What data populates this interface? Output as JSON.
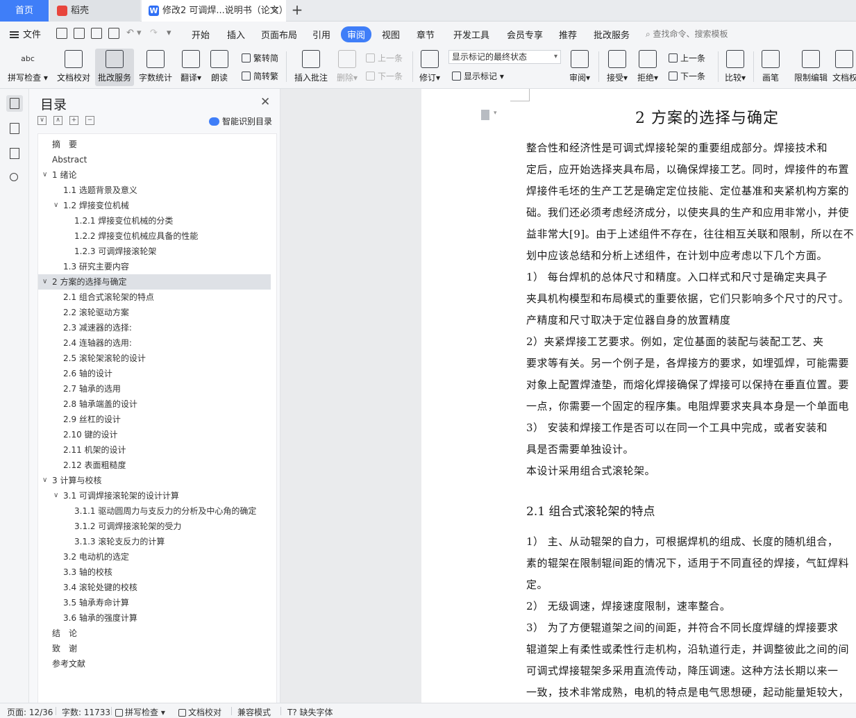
{
  "tabs": {
    "home": "首页",
    "tab1": "稻壳",
    "tab2": "修改2 可调焊...说明书（论文）"
  },
  "menu": {
    "file": "文件",
    "items": [
      "开始",
      "插入",
      "页面布局",
      "引用",
      "审阅",
      "视图",
      "章节",
      "开发工具",
      "会员专享",
      "推荐",
      "批改服务"
    ],
    "active": "审阅",
    "search": "查找命令、搜索模板"
  },
  "ribbon": {
    "spellcheck": "拼写检查",
    "doc_proof": "文档校对",
    "review_service": "批改服务",
    "word_count": "字数统计",
    "translate": "翻译",
    "read_aloud": "朗读",
    "to_simplified": "繁转简",
    "to_traditional": "简转繁",
    "insert_comment": "插入批注",
    "delete": "删除",
    "prev_comment": "上一条",
    "next_comment": "下一条",
    "revise": "修订",
    "markup_mode": "显示标记的最终状态",
    "show_markup": "显示标记",
    "review_pane": "审阅",
    "accept": "接受",
    "reject": "拒绝",
    "prev_change": "上一条",
    "next_change": "下一条",
    "compare": "比较",
    "pen": "画笔",
    "restrict_edit": "限制编辑",
    "doc_permission": "文档权"
  },
  "toc": {
    "title": "目录",
    "smart": "智能识别目录",
    "items": [
      {
        "label": "摘　要",
        "level": 1,
        "arrow": ""
      },
      {
        "label": "Abstract",
        "level": 1,
        "arrow": ""
      },
      {
        "label": "1  绪论",
        "level": 1,
        "arrow": "∨"
      },
      {
        "label": "1.1 选题背景及意义",
        "level": 2,
        "arrow": ""
      },
      {
        "label": "1.2 焊接变位机械",
        "level": 2,
        "arrow": "∨"
      },
      {
        "label": "1.2.1 焊接变位机械的分类",
        "level": 3,
        "arrow": ""
      },
      {
        "label": "1.2.2 焊接变位机械应具备的性能",
        "level": 3,
        "arrow": ""
      },
      {
        "label": "1.2.3 可调焊接滚轮架",
        "level": 3,
        "arrow": ""
      },
      {
        "label": "1.3  研究主要内容",
        "level": 2,
        "arrow": ""
      },
      {
        "label": "2  方案的选择与确定",
        "level": 1,
        "arrow": "∨"
      },
      {
        "label": "2.1 组合式滚轮架的特点",
        "level": 2,
        "arrow": ""
      },
      {
        "label": "2.2 滚轮驱动方案",
        "level": 2,
        "arrow": ""
      },
      {
        "label": "2.3 减速器的选择:",
        "level": 2,
        "arrow": ""
      },
      {
        "label": "2.4 连轴器的选用:",
        "level": 2,
        "arrow": ""
      },
      {
        "label": "2.5 滚轮架滚轮的设计",
        "level": 2,
        "arrow": ""
      },
      {
        "label": "2.6 轴的设计",
        "level": 2,
        "arrow": ""
      },
      {
        "label": "2.7 轴承的选用",
        "level": 2,
        "arrow": ""
      },
      {
        "label": "2.8 轴承端盖的设计",
        "level": 2,
        "arrow": ""
      },
      {
        "label": "2.9 丝杠的设计",
        "level": 2,
        "arrow": ""
      },
      {
        "label": "2.10 键的设计",
        "level": 2,
        "arrow": ""
      },
      {
        "label": "2.11 机架的设计",
        "level": 2,
        "arrow": ""
      },
      {
        "label": "2.12 表面粗糙度",
        "level": 2,
        "arrow": ""
      },
      {
        "label": "3  计算与校核",
        "level": 1,
        "arrow": "∨"
      },
      {
        "label": "3.1 可调焊接滚轮架的设计计算",
        "level": 2,
        "arrow": "∨"
      },
      {
        "label": "3.1.1 驱动圆周力与支反力的分析及中心角的确定",
        "level": 3,
        "arrow": ""
      },
      {
        "label": "3.1.2  可调焊接滚轮架的受力",
        "level": 3,
        "arrow": ""
      },
      {
        "label": "3.1.3 滚轮支反力的计算",
        "level": 3,
        "arrow": ""
      },
      {
        "label": "3.2 电动机的选定",
        "level": 2,
        "arrow": ""
      },
      {
        "label": "3.3 轴的校核",
        "level": 2,
        "arrow": ""
      },
      {
        "label": "3.4 滚轮处键的校核",
        "level": 2,
        "arrow": ""
      },
      {
        "label": "3.5 轴承寿命计算",
        "level": 2,
        "arrow": ""
      },
      {
        "label": "3.6 轴承的强度计算",
        "level": 2,
        "arrow": ""
      },
      {
        "label": "结　论",
        "level": 1,
        "arrow": ""
      },
      {
        "label": "致　谢",
        "level": 1,
        "arrow": ""
      },
      {
        "label": "参考文献",
        "level": 1,
        "arrow": ""
      }
    ],
    "selected_index": 9
  },
  "doc": {
    "heading": "2  方案的选择与确定",
    "lines_a": [
      "        整合性和经济性是可调式焊接轮架的重要组成部分。焊接技术和",
      "定后，应开始选择夹具布局，以确保焊接工艺。同时，焊接件的布置",
      "焊接件毛坯的生产工艺是确定定位技能、定位基准和夹紧机构方案的",
      "础。我们还必须考虑经济成分，以使夹具的生产和应用非常小，并使",
      "益非常大[9]。由于上述组件不存在，往往相互关联和限制，所以在不",
      "划中应该总结和分析上述组件，在计划中应考虑以下几个方面。",
      "        1）  每台焊机的总体尺寸和精度。入口样式和尺寸是确定夹具子",
      "夹具机构模型和布局模式的重要依据，它们只影响多个尺寸的尺寸。",
      "产精度和尺寸取决于定位器自身的放置精度",
      "        2）夹紧焊接工艺要求。例如，定位基面的装配与装配工艺、夹",
      "要求等有关。另一个例子是，各焊接方的要求，如埋弧焊，可能需要",
      "对象上配置焊渣垫，而熔化焊接确保了焊接可以保持在垂直位置。要",
      "一点，你需要一个固定的程序集。电阻焊要求夹具本身是一个单面电",
      "        3） 安装和焊接工作是否可以在同一个工具中完成，或者安装和",
      "具是否需要单独设计。",
      "        本设计采用组合式滚轮架。"
    ],
    "subheading": "2.1 组合式滚轮架的特点",
    "lines_b": [
      "    1）  主、从动辊架的自力，可根据焊机的组成、长度的随机组合，",
      "素的辊架在限制辊间距的情况下，适用于不同直径的焊接，气缸焊料",
      "定。",
      "    2）  无级调速，焊接速度限制，速率整合。",
      "    3）  为了方便辊道架之间的间距，并符合不同长度焊缝的焊接要求",
      "辊道架上有柔性或柔性行走机构，沿轨道行走，并调整彼此之间的间",
      "    可调式焊接辊架多采用直流传动，降压调速。这种方法长期以来一",
      "一致，技术非常成熟，电机的特点是电气思想硬，起动能量矩较大，"
    ]
  },
  "status": {
    "page": "页面: 12/36",
    "words": "字数: 11733",
    "spell": "拼写检查",
    "proof": "文档校对",
    "compat": "兼容模式",
    "missing_font": "缺失字体"
  }
}
